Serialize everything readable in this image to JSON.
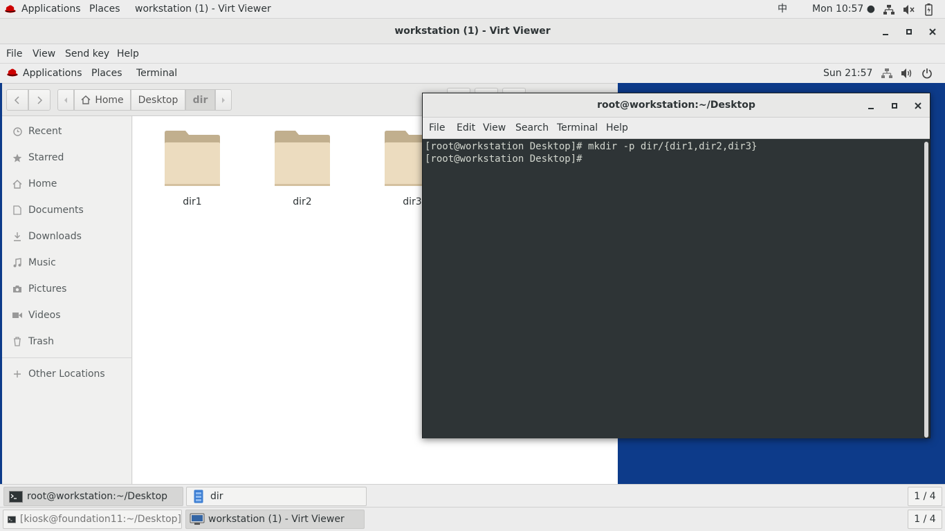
{
  "host_panel": {
    "applications": "Applications",
    "places": "Places",
    "window": "workstation (1) - Virt Viewer",
    "ime": "中",
    "clock": "Mon 10:57 ●"
  },
  "viewer": {
    "title": "workstation (1) - Virt Viewer",
    "menu": [
      "File",
      "View",
      "Send key",
      "Help"
    ]
  },
  "guest_panel": {
    "applications": "Applications",
    "places": "Places",
    "terminal": "Terminal",
    "clock": "Sun 21:57"
  },
  "files": {
    "path": [
      "Home",
      "Desktop",
      "dir"
    ],
    "sidebar": [
      {
        "label": "Recent",
        "icon": "clock-icon"
      },
      {
        "label": "Starred",
        "icon": "star-icon"
      },
      {
        "label": "Home",
        "icon": "home-icon"
      },
      {
        "label": "Documents",
        "icon": "document-icon"
      },
      {
        "label": "Downloads",
        "icon": "download-icon"
      },
      {
        "label": "Music",
        "icon": "music-icon"
      },
      {
        "label": "Pictures",
        "icon": "camera-icon"
      },
      {
        "label": "Videos",
        "icon": "video-icon"
      },
      {
        "label": "Trash",
        "icon": "trash-icon"
      },
      {
        "label": "Other Locations",
        "icon": "plus-icon"
      }
    ],
    "folders": [
      "dir1",
      "dir2",
      "dir3"
    ]
  },
  "terminal": {
    "title": "root@workstation:~/Desktop",
    "menu": [
      "File",
      "Edit",
      "View",
      "Search",
      "Terminal",
      "Help"
    ],
    "lines": [
      "[root@workstation Desktop]# mkdir -p dir/{dir1,dir2,dir3}",
      "[root@workstation Desktop]# "
    ]
  },
  "guest_taskbar": {
    "items": [
      "root@workstation:~/Desktop",
      "dir"
    ],
    "workspace": "1 / 4"
  },
  "host_taskbar": {
    "items": [
      "[kiosk@foundation11:~/Desktop]",
      "workstation (1) - Virt Viewer"
    ],
    "workspace": "1 / 4"
  }
}
